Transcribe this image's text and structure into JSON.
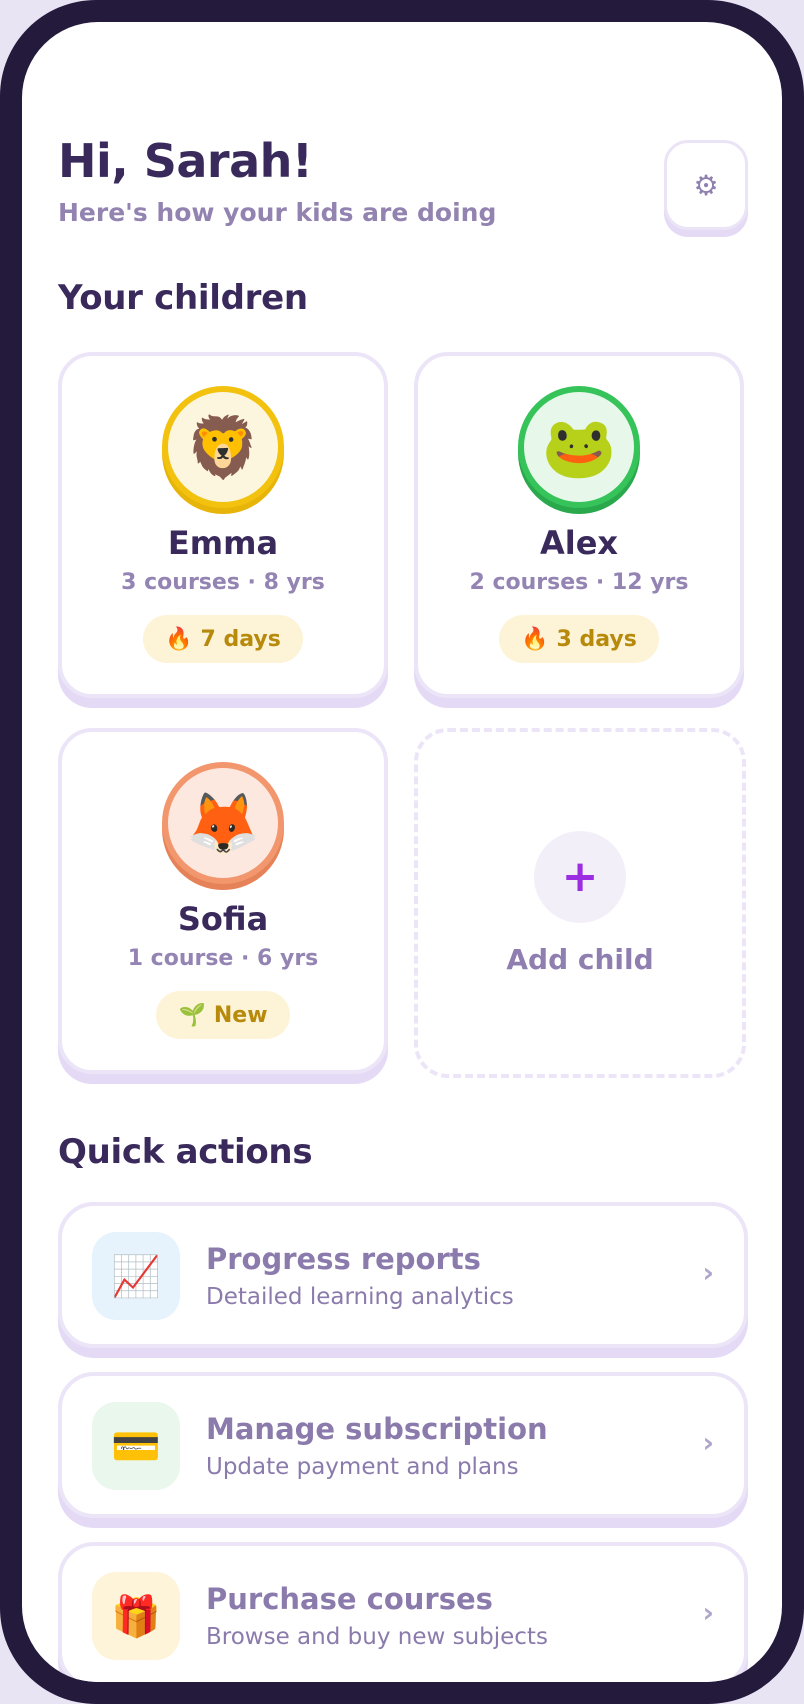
{
  "header": {
    "greeting": "Hi, Sarah!",
    "subtitle": "Here's how your kids are doing",
    "settings_icon": "gear-icon",
    "settings_glyph": "⚙"
  },
  "children_section": {
    "title": "Your children",
    "children": [
      {
        "name": "Emma",
        "meta": "3 courses · 8 yrs",
        "avatar_emoji": "🦁",
        "avatar_icon": "lion-icon",
        "avatar_bg": "#fdf6de",
        "avatar_ring": "#f2c20f",
        "badge_emoji": "🔥",
        "badge_icon": "fire-icon",
        "badge_text": "7 days"
      },
      {
        "name": "Alex",
        "meta": "2 courses · 12 yrs",
        "avatar_emoji": "🐸",
        "avatar_icon": "frog-icon",
        "avatar_bg": "#e7f7ea",
        "avatar_ring": "#35c35a",
        "badge_emoji": "🔥",
        "badge_icon": "fire-icon",
        "badge_text": "3 days"
      },
      {
        "name": "Sofia",
        "meta": "1 course · 6 yrs",
        "avatar_emoji": "🦊",
        "avatar_icon": "fox-icon",
        "avatar_bg": "#fde8e0",
        "avatar_ring": "#f2966d",
        "badge_emoji": "🌱",
        "badge_icon": "seedling-icon",
        "badge_text": "New"
      }
    ],
    "add_child": {
      "glyph": "+",
      "label": "Add child"
    }
  },
  "quick_actions": {
    "title": "Quick actions",
    "items": [
      {
        "title": "Progress reports",
        "subtitle": "Detailed learning analytics",
        "icon": "chart-icon",
        "emoji": "📈",
        "icon_bg": "#e6f3fc"
      },
      {
        "title": "Manage subscription",
        "subtitle": "Update payment and plans",
        "icon": "credit-card-icon",
        "emoji": "💳",
        "icon_bg": "#e9f7ec"
      },
      {
        "title": "Purchase courses",
        "subtitle": "Browse and buy new subjects",
        "icon": "gift-icon",
        "emoji": "🎁",
        "icon_bg": "#fdf4d9"
      }
    ],
    "chevron": "›"
  },
  "colors": {
    "heading": "#3a2a5c",
    "muted": "#9283b1",
    "accent": "#9a2ee0",
    "streak_text": "#b78a0c"
  }
}
